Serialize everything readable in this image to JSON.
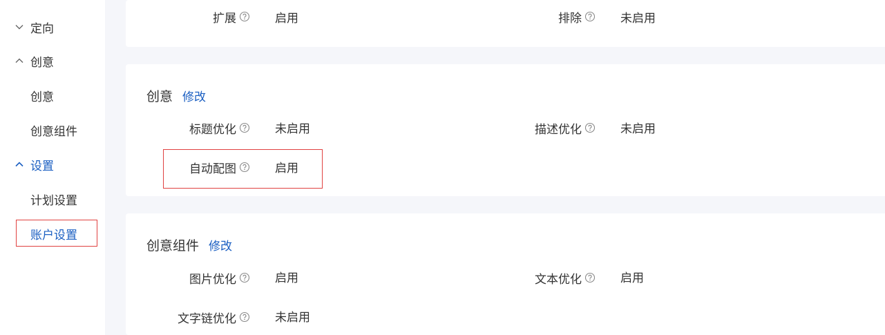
{
  "sidebar": {
    "groups": [
      {
        "label": "定向",
        "state": "collapsed"
      },
      {
        "label": "创意",
        "state": "expanded"
      },
      {
        "label": "设置",
        "state": "expanded"
      }
    ],
    "items": [
      {
        "label": "创意"
      },
      {
        "label": "创意组件"
      },
      {
        "label": "计划设置"
      },
      {
        "label": "账户设置"
      }
    ]
  },
  "top_card": {
    "fields": [
      {
        "label": "扩展",
        "value": "启用"
      },
      {
        "label": "排除",
        "value": "未启用"
      }
    ]
  },
  "creative_card": {
    "title": "创意",
    "edit_label": "修改",
    "fields": [
      {
        "label": "标题优化",
        "value": "未启用"
      },
      {
        "label": "描述优化",
        "value": "未启用"
      },
      {
        "label": "自动配图",
        "value": "启用"
      }
    ]
  },
  "component_card": {
    "title": "创意组件",
    "edit_label": "修改",
    "fields": [
      {
        "label": "图片优化",
        "value": "启用"
      },
      {
        "label": "文本优化",
        "value": "启用"
      },
      {
        "label": "文字链优化",
        "value": "未启用"
      }
    ]
  },
  "colors": {
    "accent": "#1b5fc2",
    "highlight": "#e0403f",
    "background": "#f5f6fa"
  }
}
